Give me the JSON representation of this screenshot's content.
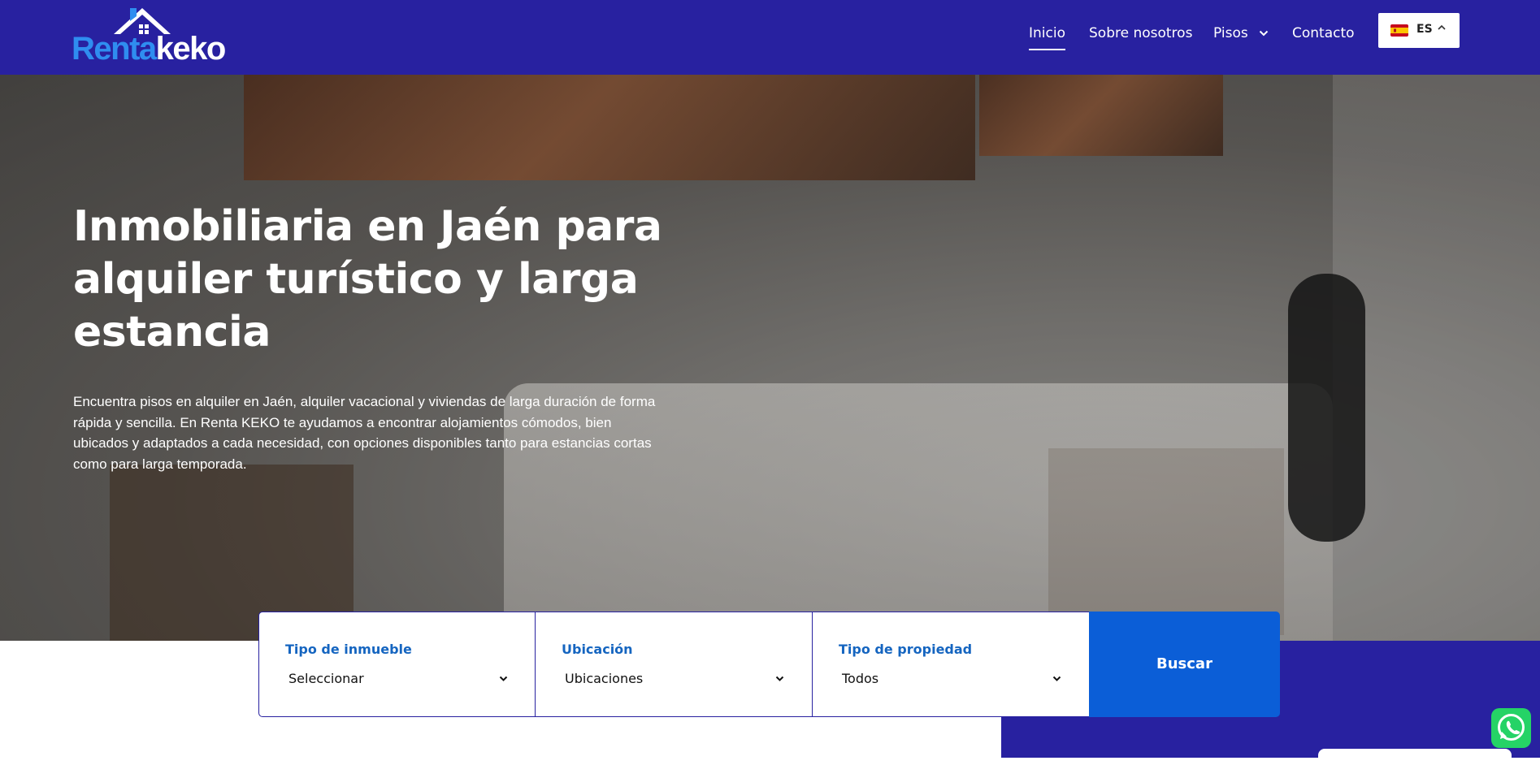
{
  "header": {
    "logo": {
      "part1": "Renta",
      "part2": "keko"
    },
    "nav": [
      {
        "label": "Inicio",
        "active": true
      },
      {
        "label": "Sobre nosotros",
        "active": false
      },
      {
        "label": "Pisos",
        "active": false,
        "dropdown": true
      },
      {
        "label": "Contacto",
        "active": false
      }
    ],
    "language": {
      "code": "ES",
      "flag_icon": "spain-flag-icon"
    }
  },
  "hero": {
    "title": "Inmobiliaria en Jaén para alquiler turístico y larga estancia",
    "description": "Encuentra pisos en alquiler en Jaén, alquiler vacacional y viviendas de larga duración de forma rápida y sencilla. En Renta KEKO te ayudamos a encontrar alojamientos cómodos, bien ubicados y adaptados a cada necesidad, con opciones disponibles tanto para estancias cortas como para larga temporada."
  },
  "search": {
    "fields": [
      {
        "label": "Tipo de inmueble",
        "value": "Seleccionar"
      },
      {
        "label": "Ubicación",
        "value": "Ubicaciones"
      },
      {
        "label": "Tipo de propiedad",
        "value": "Todos"
      }
    ],
    "button_label": "Buscar"
  },
  "colors": {
    "header_bg": "#2821a0",
    "accent_blue": "#0b5ed7",
    "label_blue": "#1565c0",
    "logo_light_blue": "#2f8df0",
    "whatsapp_green": "#25d366"
  },
  "floating": {
    "whatsapp_icon": "whatsapp-icon"
  }
}
